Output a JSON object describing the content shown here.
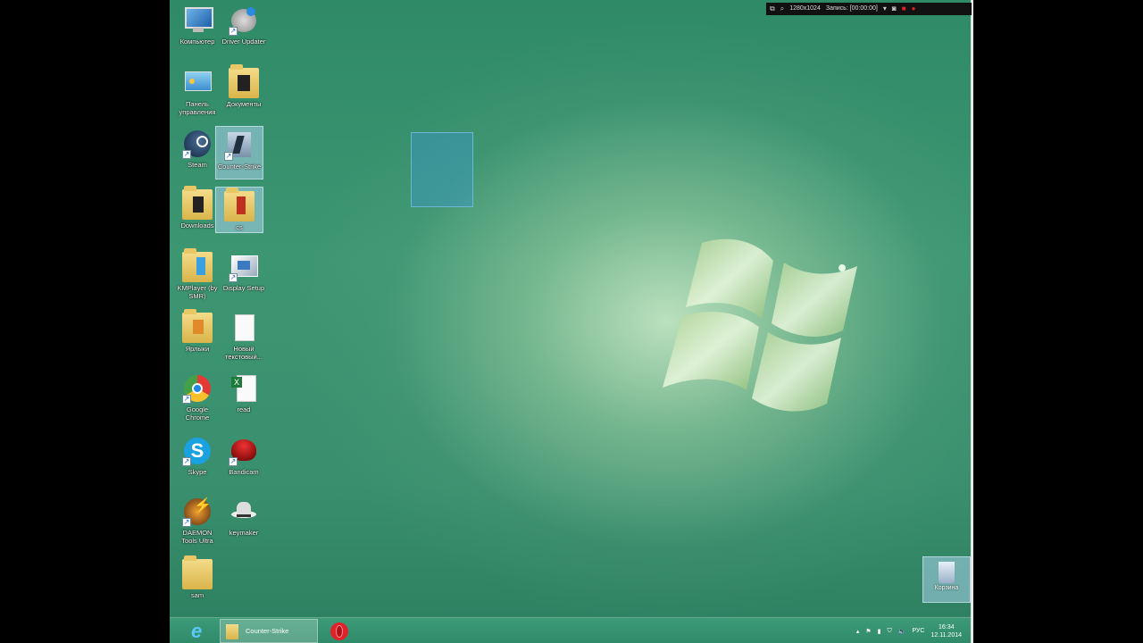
{
  "recorder": {
    "resolution": "1280x1024",
    "record_label": "Запись: [00:00:00]"
  },
  "desktop": {
    "icons": [
      {
        "label": "Компьютер"
      },
      {
        "label": "Driver Updater"
      },
      {
        "label": "Панель управления"
      },
      {
        "label": "Документы"
      },
      {
        "label": "Steam"
      },
      {
        "label": "Counter-Strike"
      },
      {
        "label": "Downloads"
      },
      {
        "label": "cs"
      },
      {
        "label": "KMPlayer (by SMR)"
      },
      {
        "label": "Display Setup"
      },
      {
        "label": "Ярлыки"
      },
      {
        "label": "Новый текстовый..."
      },
      {
        "label": "Google Chrome"
      },
      {
        "label": "read"
      },
      {
        "label": "Skype"
      },
      {
        "label": "Bandicam"
      },
      {
        "label": "DAEMON Tools Ultra"
      },
      {
        "label": "keymaker"
      },
      {
        "label": "sam"
      }
    ],
    "recycle_bin": {
      "label": "Корзина"
    }
  },
  "taskbar": {
    "explorer_label": "Counter-Strike",
    "tray": {
      "language": "РУС",
      "time": "16:34",
      "date": "12.11.2014"
    }
  },
  "colors": {
    "desktop_green": "#398f6e",
    "taskbar_green": "#2f8a6a",
    "selection_blue": "#3c96c8"
  }
}
